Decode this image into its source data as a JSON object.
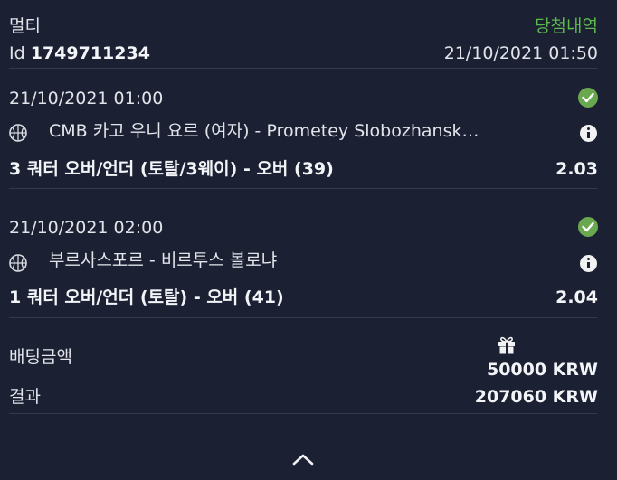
{
  "header": {
    "type_label": "멀티",
    "win_history_link": "당첨내역",
    "id_prefix": "Id",
    "id_value": "1749711234",
    "datetime": "21/10/2021 01:50"
  },
  "selections": [
    {
      "datetime": "21/10/2021 01:00",
      "match": "CMB 카고 우니 요르 (여자) - Prometey Slobozhansk…",
      "market": "3 쿼터 오버/언더 (토탈/3웨이) - 오버 (39)",
      "odds": "2.03",
      "status": "won",
      "sport_icon": "basketball-icon"
    },
    {
      "datetime": "21/10/2021 02:00",
      "match": "부르사스포르 - 비르투스 볼로냐",
      "market": "1 쿼터 오버/언더 (토탈) - 오버 (41)",
      "odds": "2.04",
      "status": "won",
      "sport_icon": "basketball-icon"
    }
  ],
  "summary": {
    "stake_label": "배팅금액",
    "stake_value": "50000 KRW",
    "result_label": "결과",
    "result_value": "207060 KRW",
    "bonus_icon": "gift-icon"
  },
  "footer": {
    "collapse_icon": "chevron-up-icon"
  },
  "colors": {
    "background": "#1b2033",
    "accent_green": "#5db84e",
    "check_green": "#6aa84f",
    "divider": "#323a4f"
  }
}
